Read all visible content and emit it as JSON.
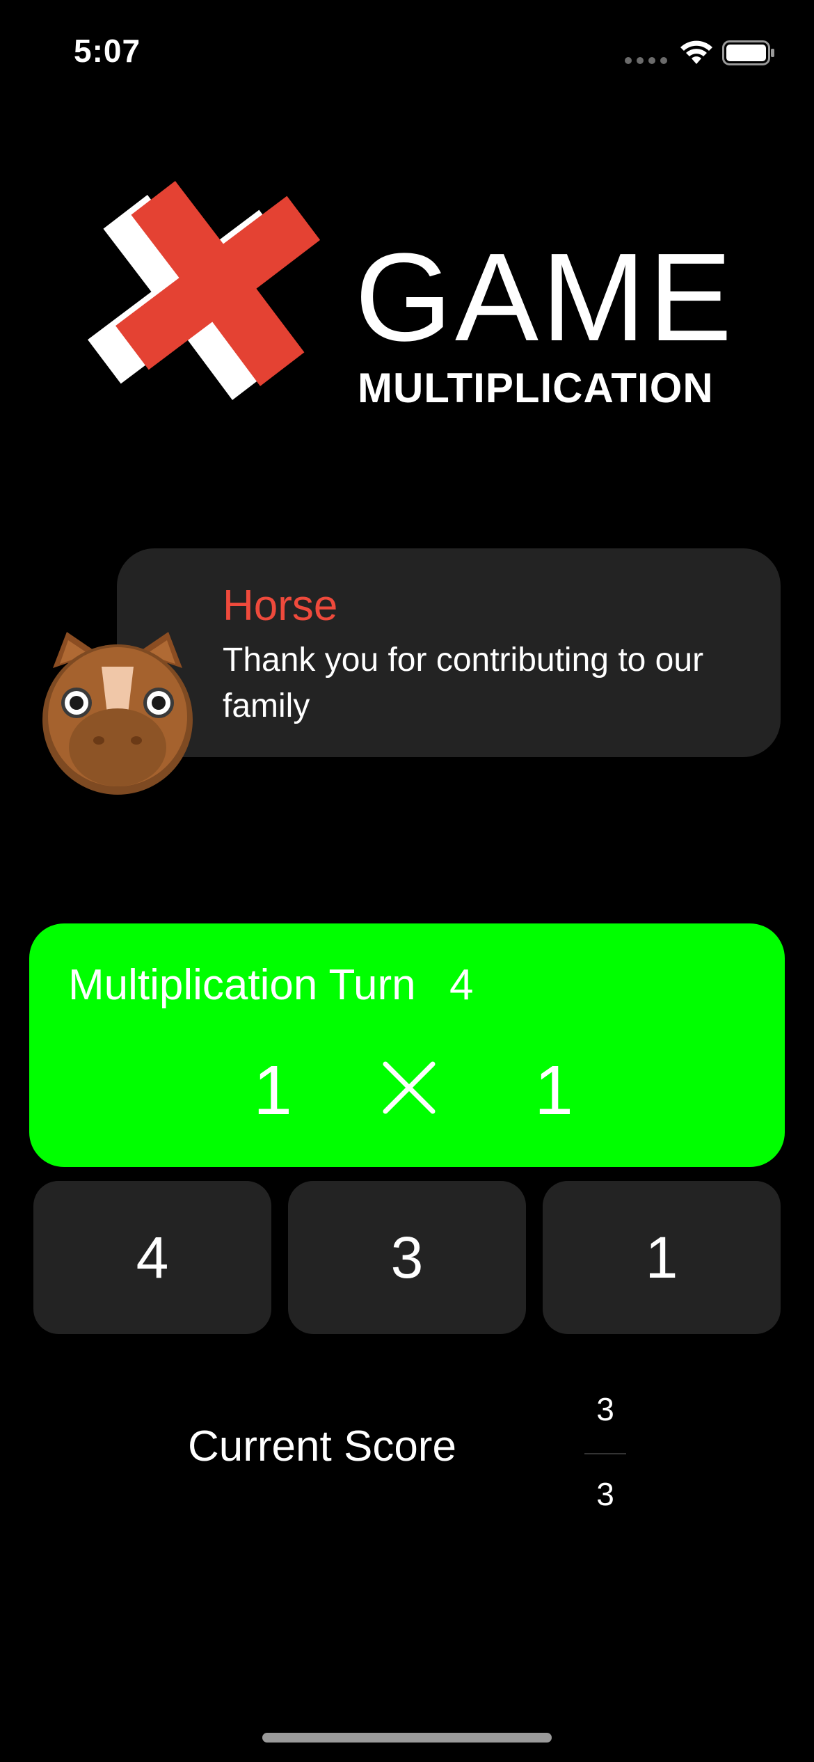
{
  "status_bar": {
    "time": "5:07",
    "icons": [
      "signal-icon",
      "wifi-icon",
      "battery-icon"
    ]
  },
  "logo": {
    "title": "GAME",
    "subtitle": "MULTIPLICATION",
    "mark_icon": "multiply-cross-icon",
    "mark_color": "#e44233"
  },
  "message": {
    "title": "Horse",
    "body": "Thank you for contributing to our family",
    "avatar_icon": "horse-icon",
    "title_color": "#ef4a3c"
  },
  "question": {
    "turn_label": "Multiplication Turn",
    "turn_number": "4",
    "operand_a": "1",
    "operator_icon": "multiply-icon",
    "operand_b": "1",
    "background": "#00ff00"
  },
  "answers": [
    {
      "label": "4"
    },
    {
      "label": "3"
    },
    {
      "label": "1"
    }
  ],
  "score": {
    "label": "Current Score",
    "numerator": "3",
    "denominator": "3"
  }
}
